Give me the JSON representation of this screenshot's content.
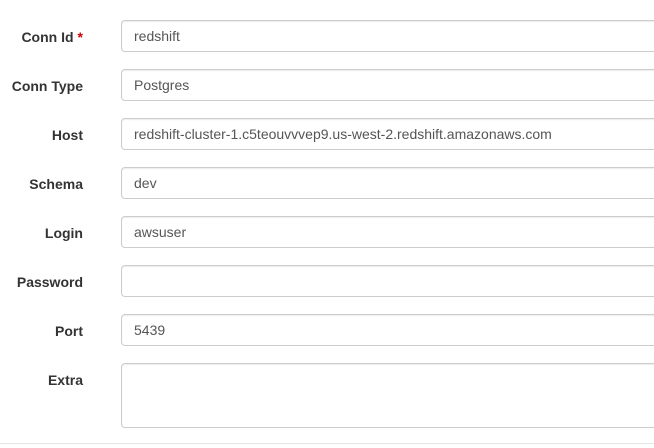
{
  "form": {
    "fields": [
      {
        "label": "Conn Id",
        "required_marker": "*",
        "value": ""
      },
      {
        "label": "Conn Type",
        "value": "Postgres"
      },
      {
        "label": "Host",
        "value": "redshift-cluster-1.c5teouvvvep9.us-west-2.redshift.amazonaws.com"
      },
      {
        "label": "Schema",
        "value": "dev"
      },
      {
        "label": "Login",
        "value": "awsuser"
      },
      {
        "label": "Password",
        "value": ""
      },
      {
        "label": "Port",
        "value": "5439"
      },
      {
        "label": "Extra",
        "value": ""
      }
    ],
    "conn_id_value": "redshift"
  },
  "colors": {
    "label_text": "#333333",
    "input_text": "#555555",
    "input_border": "#cccccc",
    "required": "#cc0000"
  }
}
